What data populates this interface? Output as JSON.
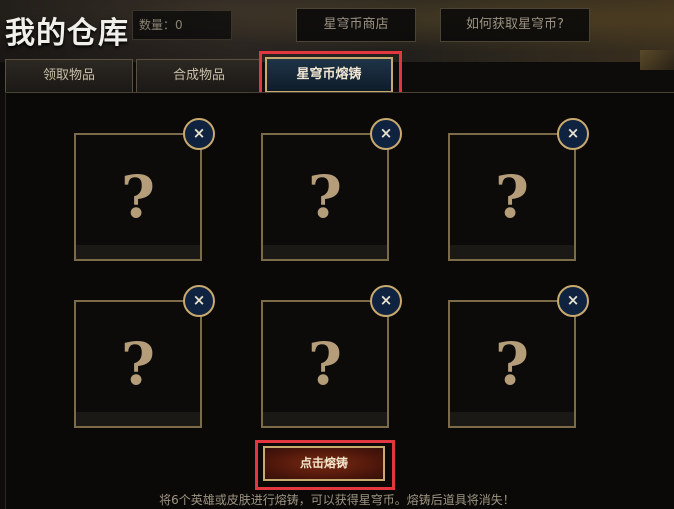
{
  "header": {
    "title": "我的仓库",
    "count_label": "数量：0",
    "shop_button": "星穹币商店",
    "howto_button": "如何获取星穹币?"
  },
  "tabs": [
    {
      "label": "领取物品",
      "active": false
    },
    {
      "label": "合成物品",
      "active": false
    },
    {
      "label": "星穹币熔铸",
      "active": true
    }
  ],
  "slots": [
    {
      "placeholder": "?",
      "remove": "×"
    },
    {
      "placeholder": "?",
      "remove": "×"
    },
    {
      "placeholder": "?",
      "remove": "×"
    },
    {
      "placeholder": "?",
      "remove": "×"
    },
    {
      "placeholder": "?",
      "remove": "×"
    },
    {
      "placeholder": "?",
      "remove": "×"
    }
  ],
  "smelt_button": "点击熔铸",
  "hint": "将6个英雄或皮肤进行熔铸，可以获得星穹币。熔铸后道具将消失！",
  "colors": {
    "gold_border": "#c8aa6e",
    "highlight_red": "#e2373e",
    "active_tab_blue": "#1f3447",
    "close_btn_blue": "#0f2340"
  }
}
